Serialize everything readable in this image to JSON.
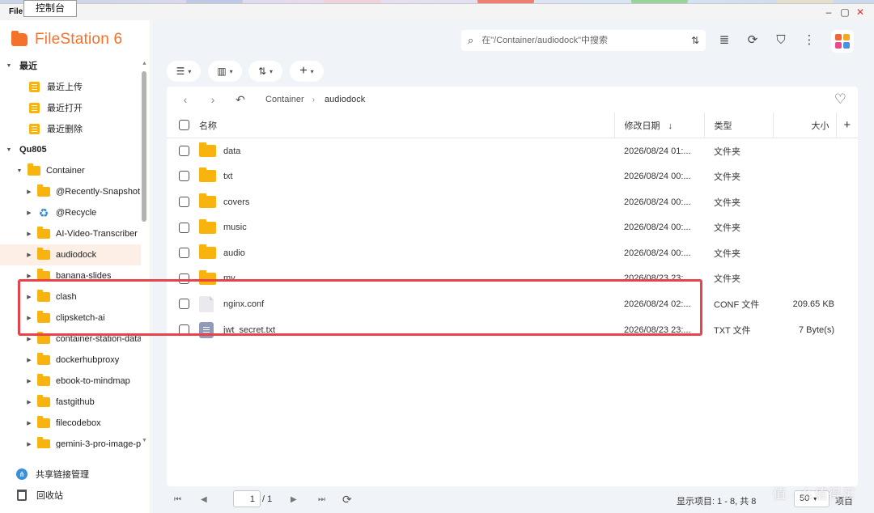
{
  "tooltip": "控制台",
  "window": {
    "title": "File"
  },
  "app": {
    "name": "FileStation 6"
  },
  "colors": {
    "accent": "#f5722a",
    "folder": "#f8b30e",
    "highlight_border": "#e8434a",
    "selected_bg": "#fdeee6"
  },
  "sidebar": {
    "recent": {
      "label": "最近",
      "items": [
        "最近上传",
        "最近打开",
        "最近删除"
      ]
    },
    "device": {
      "label": "Qu805"
    },
    "container": {
      "label": "Container"
    },
    "folders": [
      "@Recently-Snapshot",
      "@Recycle",
      "AI-Video-Transcriber",
      "audiodock",
      "banana-slides",
      "clash",
      "clipsketch-ai",
      "container-station-data",
      "dockerhubproxy",
      "ebook-to-mindmap",
      "fastgithub",
      "filecodebox",
      "gemini-3-pro-image-p"
    ],
    "selected_folder": "audiodock",
    "footer": {
      "share_link": "共享链接管理",
      "recycle_bin": "回收站"
    }
  },
  "toolbar": {
    "search_placeholder": "在\"/Container/audiodock\"中搜索",
    "icons": [
      "filter-settings-icon",
      "stack-icon",
      "refresh-icon",
      "funnel-icon",
      "more-vertical-icon",
      "apps-grid-icon"
    ]
  },
  "breadcrumb": {
    "items": [
      "Container",
      "audiodock"
    ]
  },
  "table": {
    "headers": {
      "name": "名称",
      "modified": "修改日期",
      "type": "类型",
      "size": "大小"
    },
    "sort_indicator": "↓",
    "rows": [
      {
        "name": "data",
        "modified": "2026/08/24 01:...",
        "type": "文件夹",
        "size": "",
        "kind": "folder"
      },
      {
        "name": "txt",
        "modified": "2026/08/24 00:...",
        "type": "文件夹",
        "size": "",
        "kind": "folder"
      },
      {
        "name": "covers",
        "modified": "2026/08/24 00:...",
        "type": "文件夹",
        "size": "",
        "kind": "folder"
      },
      {
        "name": "music",
        "modified": "2026/08/24 00:...",
        "type": "文件夹",
        "size": "",
        "kind": "folder"
      },
      {
        "name": "audio",
        "modified": "2026/08/24 00:...",
        "type": "文件夹",
        "size": "",
        "kind": "folder"
      },
      {
        "name": "mv",
        "modified": "2026/08/23 23:...",
        "type": "文件夹",
        "size": "",
        "kind": "folder"
      },
      {
        "name": "nginx.conf",
        "modified": "2026/08/24 02:...",
        "type": "CONF 文件",
        "size": "209.65 KB",
        "kind": "conf"
      },
      {
        "name": "jwt_secret.txt",
        "modified": "2026/08/23 23:...",
        "type": "TXT 文件",
        "size": "7 Byte(s)",
        "kind": "txt"
      }
    ]
  },
  "pagination": {
    "current_page": "1",
    "total": "/ 1",
    "status": "显示项目: 1 - 8, 共 8",
    "page_size": "50",
    "items_label": "项目"
  },
  "watermark": "值 · 么值得买"
}
